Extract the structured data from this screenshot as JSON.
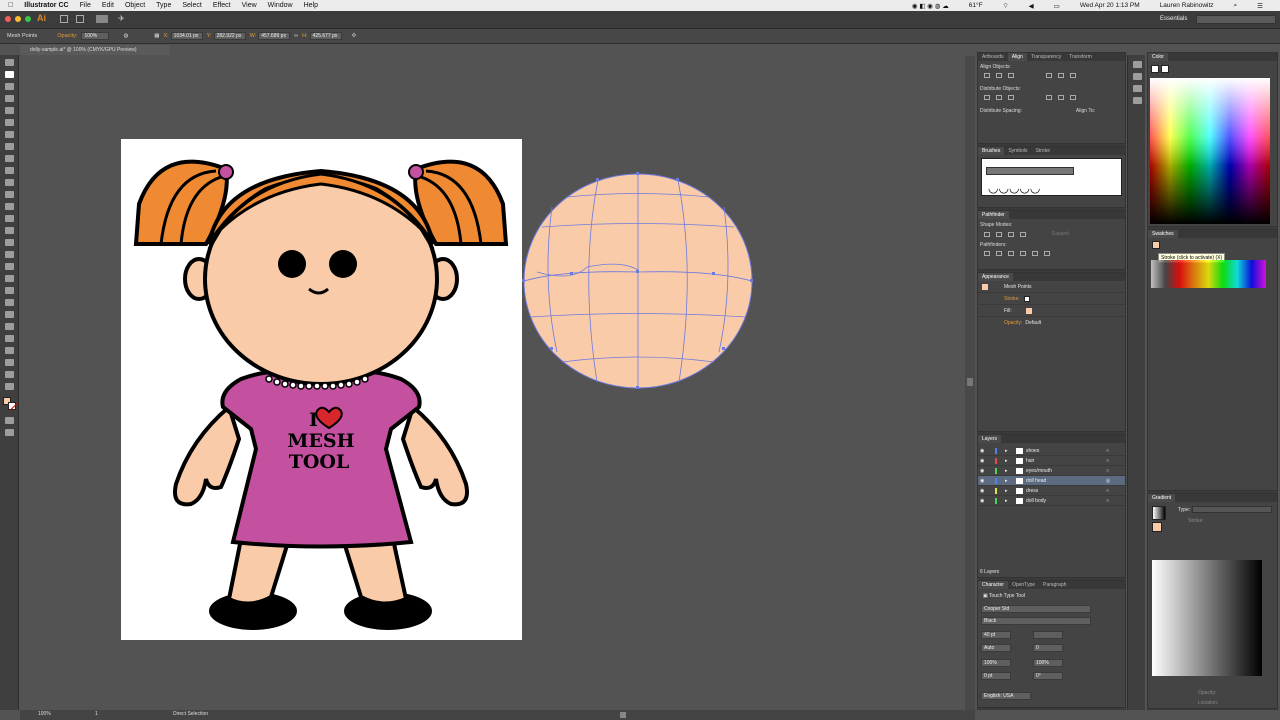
{
  "menubar": {
    "apple": "",
    "app": "Illustrator CC",
    "items": [
      "File",
      "Edit",
      "Object",
      "Type",
      "Select",
      "Effect",
      "View",
      "Window",
      "Help"
    ],
    "temp": "61°F",
    "battery": "",
    "clock": "Wed Apr 20  1:13 PM",
    "user": "Lauren Rabinowitz"
  },
  "appbar": {
    "logo": "Ai",
    "workspace": "Essentials"
  },
  "control": {
    "selection": "Mesh Points",
    "opacity_label": "Opacity:",
    "opacity": "100%",
    "x_label": "X:",
    "x": "1034.01 px",
    "y_label": "Y:",
    "y": "282.922 px",
    "w_label": "W:",
    "w": "457.689 px",
    "h_label": "H:",
    "h": "425.677 px"
  },
  "document": {
    "tab": "dolly-sample.ai* @ 100% (CMYK/GPU Preview)"
  },
  "shirt": {
    "line1": "I",
    "line2": "MESH",
    "line3": "TOOL"
  },
  "panels": {
    "align": {
      "tabs": [
        "Artboards",
        "Align",
        "Transparency",
        "Transform"
      ],
      "align_objects": "Align Objects:",
      "distribute_objects": "Distribute Objects:",
      "distribute_spacing": "Distribute Spacing:",
      "align_to": "Align To:"
    },
    "brushes": {
      "tabs": [
        "Brushes",
        "Symbols",
        "Stroke"
      ]
    },
    "pathfinder": {
      "title": "Pathfinder",
      "shape_modes": "Shape Modes:",
      "expand": "Expand",
      "pathfinders": "Pathfinders:"
    },
    "appearance": {
      "title": "Appearance",
      "object": "Mesh Points",
      "stroke": "Stroke:",
      "fill": "Fill:",
      "opacity": "Opacity:",
      "opacity_value": "Default"
    },
    "layers": {
      "title": "Layers",
      "rows": [
        {
          "name": "shoes",
          "color": "#4f7ff0"
        },
        {
          "name": "hair",
          "color": "#e84848"
        },
        {
          "name": "eyes/mouth",
          "color": "#4fd15a"
        },
        {
          "name": "doll head",
          "color": "#4f7ff0"
        },
        {
          "name": "dress",
          "color": "#e0e040"
        },
        {
          "name": "doll body",
          "color": "#4fd15a"
        }
      ],
      "count": "6 Layers"
    },
    "character": {
      "tabs": [
        "Character",
        "OpenType",
        "Paragraph"
      ],
      "touch_tool": "Touch Type Tool",
      "font": "Cooper Std",
      "style": "Black",
      "size": "40 pt",
      "tracking": "Auto",
      "scale_v": "100%",
      "scale_h": "100%",
      "baseline": "0 pt",
      "rotation": "0°",
      "language": "English: USA"
    },
    "color": {
      "title": "Color"
    },
    "swatches": {
      "title": "Swatches",
      "tooltip": "Stroke (click to activate) (X)"
    },
    "gradient": {
      "title": "Gradient",
      "type_label": "Type:",
      "stroke_label": "Stroke:",
      "opacity_label": "Opacity:",
      "location_label": "Location:"
    }
  },
  "status": {
    "zoom": "100%",
    "page": "1",
    "tool": "Direct Selection"
  },
  "colors": {
    "skin": "#f9cba8",
    "hair": "#ef8a32",
    "dress": "#c4519f",
    "mesh": "#6c7ae0",
    "heart": "#d8262e"
  }
}
